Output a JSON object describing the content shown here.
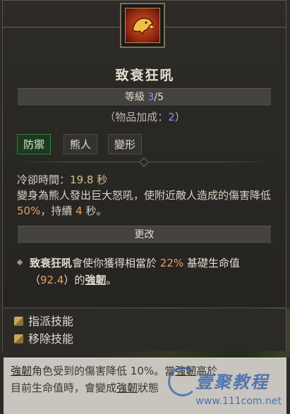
{
  "skill": {
    "name": "致衰狂吼",
    "rank_label": "等級 ",
    "rank_current": "3",
    "rank_max": "/5",
    "bonus_prefix": "（物品加成：",
    "bonus_value": "2",
    "bonus_suffix": "）",
    "tags": [
      "防禦",
      "熊人",
      "變形"
    ],
    "cooldown_label": "冷卻時間：",
    "cooldown_value": "19.8 秒",
    "desc_part1": "變身為熊人發出巨大怒吼，使附近敵人造成的傷害降低 ",
    "desc_pct": "50%",
    "desc_part2": "，持續 ",
    "desc_duration": "4",
    "desc_part3": " 秒。"
  },
  "modifier": {
    "header": "更改",
    "text_part1": "致衰狂吼",
    "text_part2": "會使你獲得相當於 ",
    "pct": "22%",
    "text_part3": " 基礎生命值（",
    "value": "92.4",
    "text_part4": "）的",
    "keyword": "強韌",
    "text_part5": "。"
  },
  "actions": {
    "assign": "指派技能",
    "remove": "移除技能"
  },
  "tooltip": {
    "line1_kw": "強韌",
    "line1_rest": "角色受到的傷害降低 10%。當",
    "line1_kw2": "強韌",
    "line1_end": "高於",
    "line2_part1": "目前生命值時，會變成",
    "line2_kw": "強韌",
    "line2_end": "狀態"
  },
  "watermark": {
    "text": "壹聚教程",
    "url": "www.111com.net"
  },
  "icons": {
    "skill_icon": "bear-roar-icon",
    "action_key_icon": "key-icon"
  }
}
